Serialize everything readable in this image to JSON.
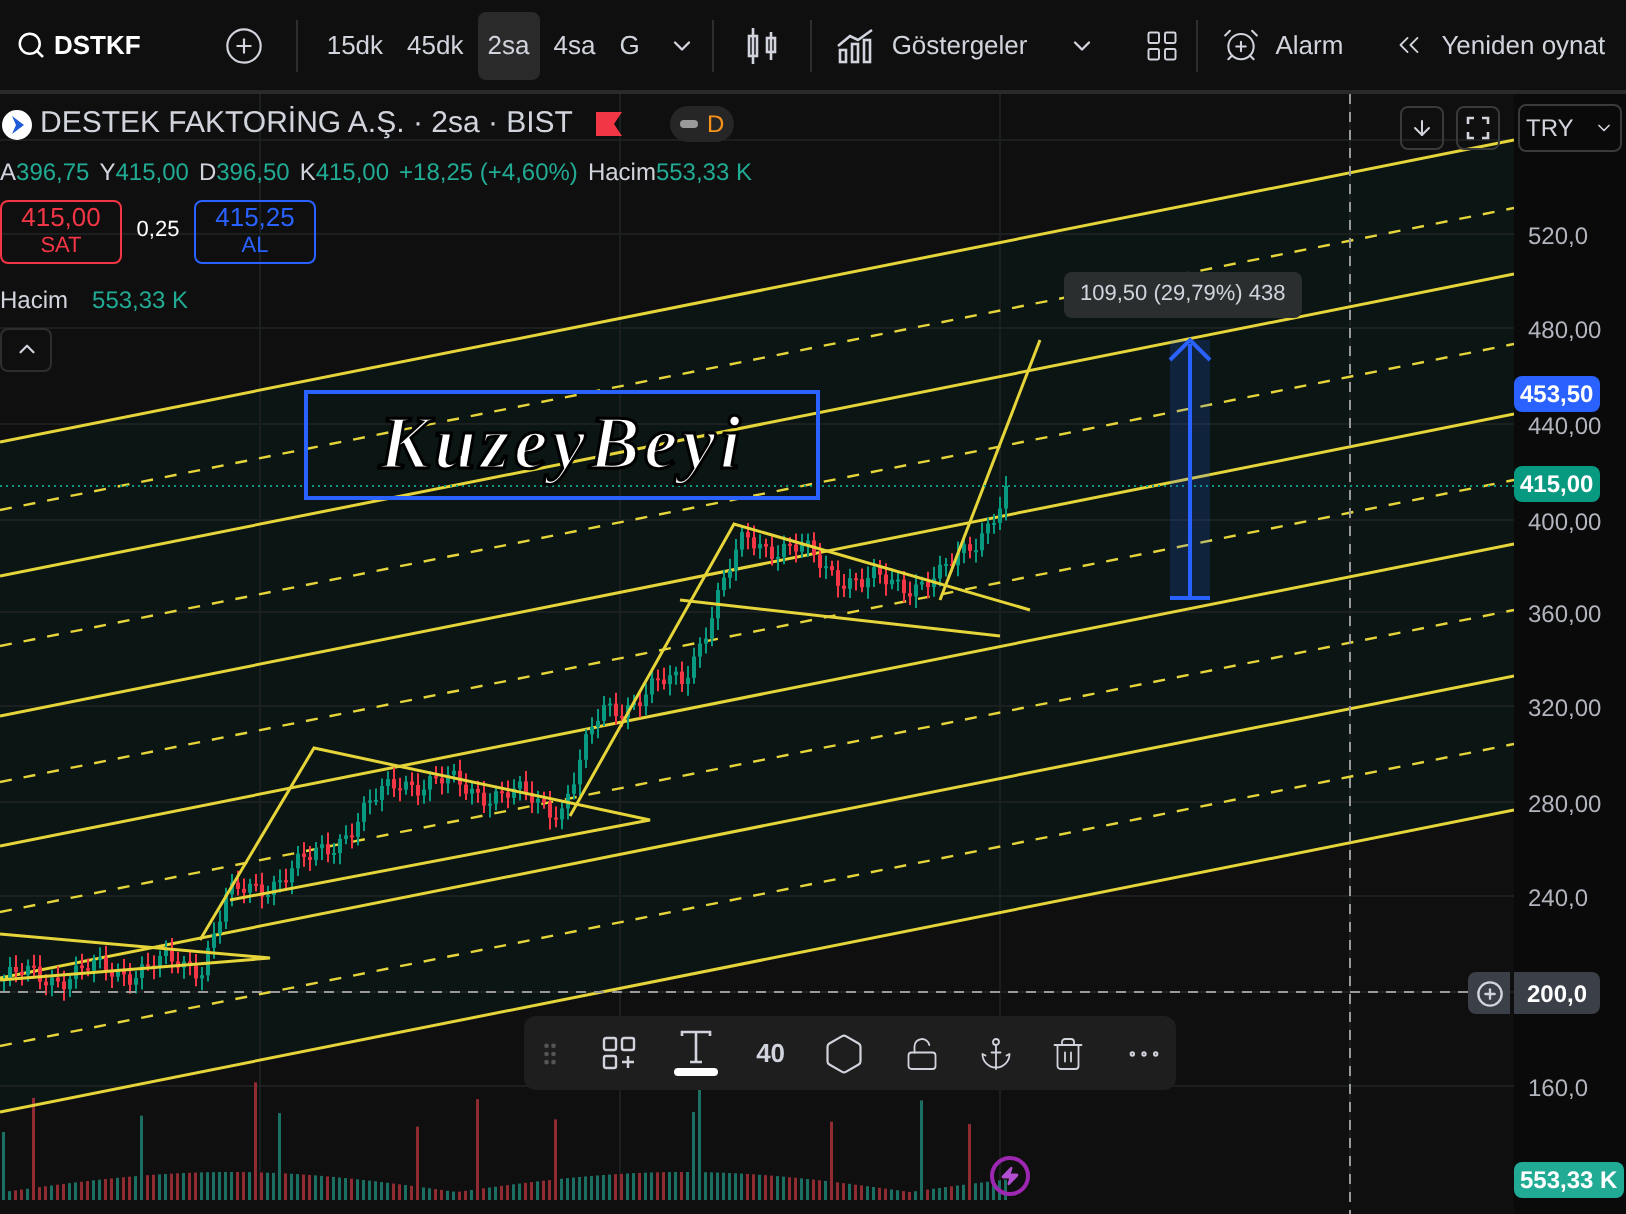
{
  "toolbar": {
    "symbol": "DSTKF",
    "intervals": [
      {
        "label": "15dk",
        "selected": false
      },
      {
        "label": "45dk",
        "selected": false
      },
      {
        "label": "2sa",
        "selected": true
      },
      {
        "label": "4sa",
        "selected": false
      },
      {
        "label": "G",
        "selected": false
      }
    ],
    "indicators": "Göstergeler",
    "alarm": "Alarm",
    "replay": "Yeniden oynat"
  },
  "legend": {
    "title": "DESTEK FAKTORİNG A.Ş. · 2sa · BIST",
    "status_badge": "D",
    "ohlc": [
      {
        "key": "A",
        "value": "396,75"
      },
      {
        "key": "Y",
        "value": "415,00"
      },
      {
        "key": "D",
        "value": "396,50"
      },
      {
        "key": "K",
        "value": "415,00"
      }
    ],
    "change": "+18,25 (+4,60%)",
    "volume_label": "Hacim",
    "volume_value": "553,33 K"
  },
  "order": {
    "sell_price": "415,00",
    "sell_label": "SAT",
    "spread": "0,25",
    "buy_price": "415,25",
    "buy_label": "AL"
  },
  "volume_study": {
    "label": "Hacim",
    "value": "553,33 K"
  },
  "currency": "TRY",
  "text_drawing": "KuzeyBeyi",
  "measure_label": "109,50 (29,79%) 438",
  "price_axis": [
    {
      "label": "520,0",
      "highlighted": false
    },
    {
      "label": "480,00",
      "highlighted": false
    },
    {
      "label": "440,00",
      "highlighted": false
    },
    {
      "label": "400,00",
      "highlighted": false
    },
    {
      "label": "360,00",
      "highlighted": false
    },
    {
      "label": "320,00",
      "highlighted": false
    },
    {
      "label": "280,00",
      "highlighted": false
    },
    {
      "label": "240,0",
      "highlighted": false
    },
    {
      "label": "200,0",
      "highlighted": true
    },
    {
      "label": "160,0",
      "highlighted": false
    }
  ],
  "price_labels": [
    {
      "text": "453,50",
      "color": "#2962ff"
    },
    {
      "text": "415,00",
      "color": "#089981"
    },
    {
      "text": "553,33 K",
      "color": "#22ab94"
    }
  ],
  "drawing_toolbar": {
    "font_size": "40"
  }
}
